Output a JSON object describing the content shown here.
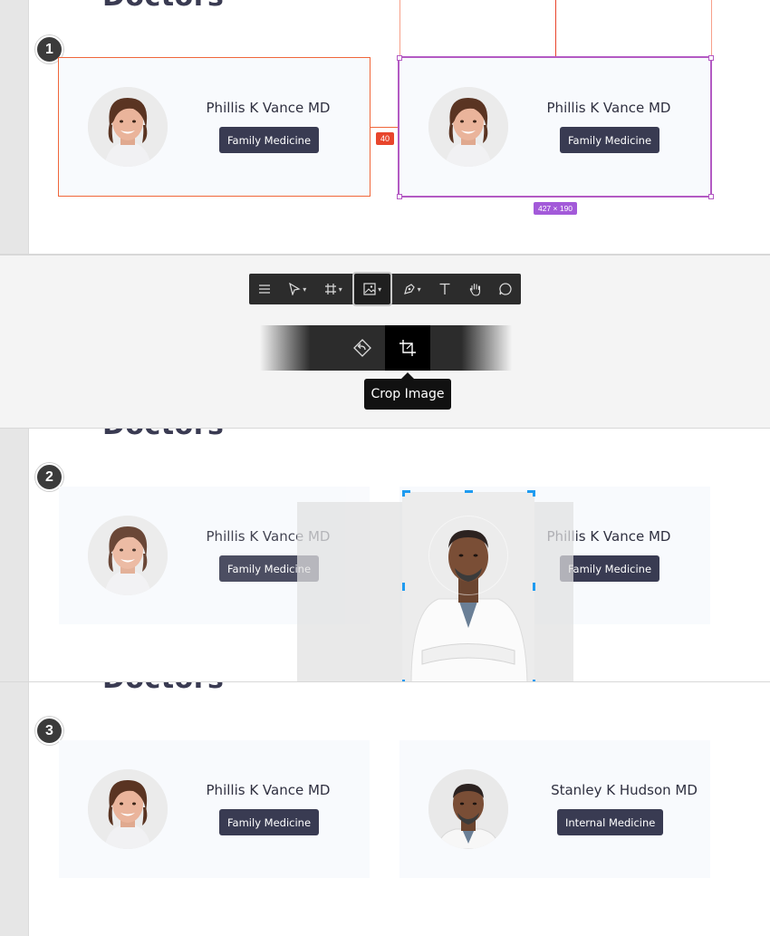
{
  "steps": [
    "1",
    "2",
    "3"
  ],
  "section_heading": "Doctors",
  "doctor_a": {
    "name": "Phillis K Vance MD",
    "specialty": "Family Medicine"
  },
  "doctor_b": {
    "name": "Stanley K Hudson MD",
    "specialty": "Internal Medicine"
  },
  "measure": {
    "gap": "40",
    "size": "427 × 190"
  },
  "toolbar": {
    "tools": [
      "main-menu-icon",
      "move-tool-icon",
      "frame-tool-icon",
      "image-tool-icon",
      "pen-tool-icon",
      "text-tool-icon",
      "hand-tool-icon",
      "comment-icon"
    ],
    "sub_tools": [
      "replace-image-icon",
      "crop-image-icon"
    ],
    "tooltip": "Crop Image"
  },
  "colors": {
    "accent_orange": "#f0663a",
    "selection_purple": "#b35ac3",
    "crop_blue": "#1e9bf0",
    "badge": "#393b52"
  }
}
